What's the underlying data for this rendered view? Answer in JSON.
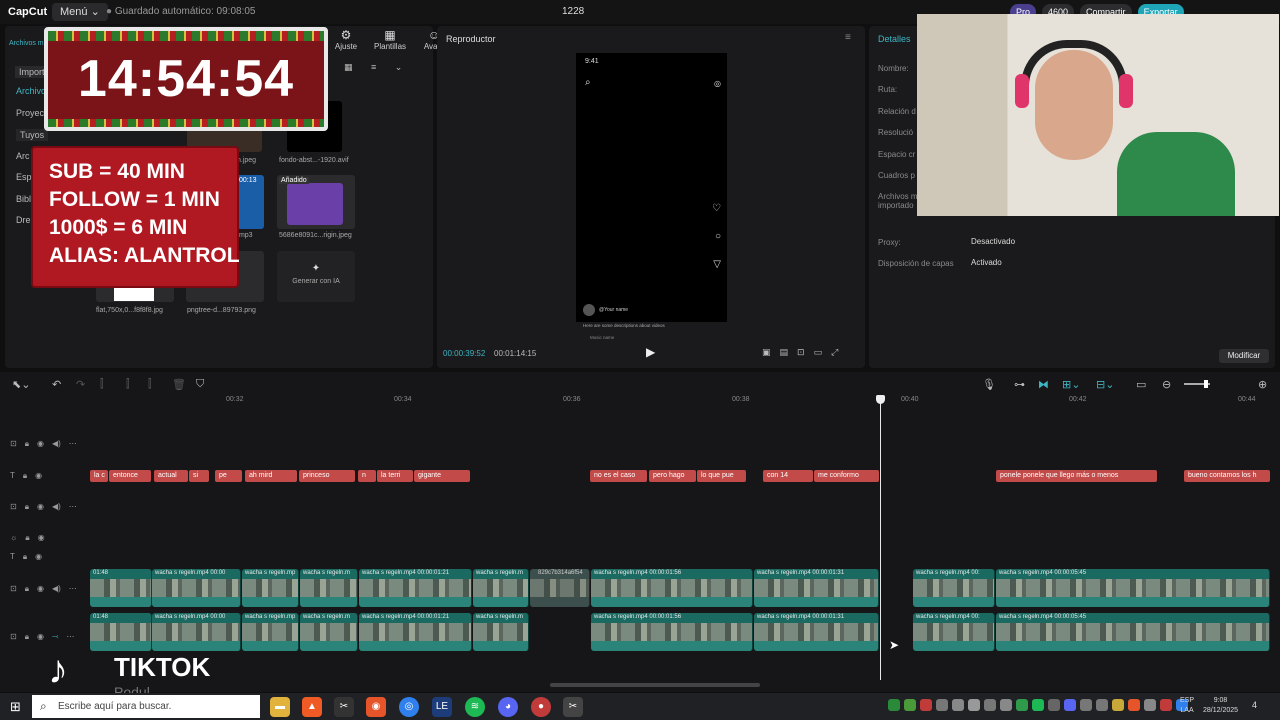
{
  "titlebar": {
    "app_name": "CapCut",
    "menu_label": "Menú ⌄",
    "autosave": "Guardado automático: 09:08:05",
    "project_name": "1228",
    "pro_label": "Pro",
    "coins": "4600",
    "share_label": "Compartir",
    "export_label": "Exportar"
  },
  "media_panel": {
    "nav": {
      "import": "Import",
      "archivos": "Archivo",
      "proyectos": "Proyect",
      "tuyos": "Tuyos",
      "arch2": "Arc",
      "esp": "Esp",
      "bibl": "Bibl",
      "dre": "Dre",
      "archivos_top": "Archivos m"
    },
    "tools": [
      {
        "icon": "⚙",
        "label": "Ajuste"
      },
      {
        "icon": "▦",
        "label": "Plantillas"
      },
      {
        "icon": "☺",
        "label": "Avata"
      }
    ],
    "thumbs": [
      {
        "caption": "n.jpeg"
      },
      {
        "caption": "fondo-abst...-1920.avif"
      },
      {
        "caption": ".mp3",
        "badge": "00:13"
      },
      {
        "caption": "5686e8091c...rigin.jpeg",
        "badge": "Añadido"
      },
      {
        "caption": "flat,750x,0...f8f8f8.jpg"
      },
      {
        "caption": "pngtree-d...89793.png"
      },
      {
        "caption": "Generar con IA"
      }
    ]
  },
  "overlays": {
    "clock": "14:54:54",
    "sub_lines": [
      "SUB = 40 MIN",
      "FOLLOW = 1 MIN",
      "1000$ = 6 MIN",
      "ALIAS: ALANTROL"
    ]
  },
  "player": {
    "title": "Reproductor",
    "phone_time": "9:41",
    "phone_user": "@Your name",
    "phone_desc": "Here are some descriptions about videos",
    "phone_music": "Music name",
    "current_time": "00:00:39:52",
    "total_time": "00:01:14:15"
  },
  "details": {
    "title": "Detalles",
    "labels": [
      "Nombre:",
      "Ruta:",
      "Relación d",
      "Resolució",
      "Espacio cr",
      "Cuadros p",
      "Archivos m importado"
    ],
    "proxy_label": "Proxy:",
    "proxy_value": "Desactivado",
    "layers_label": "Disposición de capas",
    "layers_value": "Activado",
    "modify_label": "Modificar"
  },
  "timeline": {
    "ruler": [
      "00:32",
      "00:34",
      "00:36",
      "00:38",
      "00:40",
      "00:42",
      "00:44"
    ],
    "text_clips": [
      "la c",
      "entonce",
      "actual",
      "si",
      "pe",
      "ah mird",
      "princeso",
      "n",
      "la terri",
      "gigante",
      "no es el caso",
      "pero hago",
      "lo que pue",
      "con 14",
      "me conformo",
      "ponele ponele que llego más o menos",
      "bueno contamos los h"
    ],
    "video_clips_top": [
      "01:48",
      "wacha s regeln.mp4  00:00",
      "wacha s regeln.mp",
      "wacha s regeln.m",
      "wacha s regeln.mp4  00:00:01:21",
      "wacha s regeln.m",
      "829c7b314a6f54",
      "wacha s regeln.mp4  00:00:01:56",
      "wacha s regeln.mp4  00:00:01:31",
      "wacha s regeln.mp4  00:",
      "wacha s regeln.mp4  00:00:05:45"
    ],
    "video_clips_bottom": [
      "01:48",
      "wacha s regeln.mp4  00:00",
      "wacha s regeln.mp",
      "wacha s regeln.m",
      "wacha s regeln.mp4  00:00:01:21",
      "wacha s regeln.m",
      "wacha s regeln.mp4  00:00:01:56",
      "wacha s regeln.mp4  00:00:01:31",
      "wacha s regeln.mp4  00:",
      "wacha s regeln.mp4  00:00:05:45"
    ]
  },
  "watermark": {
    "text": "TIKTOK",
    "sub": "Podul"
  },
  "taskbar": {
    "search_placeholder": "Escribe aquí para buscar.",
    "lang": "ESP\nLAA",
    "time": "9:08",
    "date": "28/12/2025",
    "notif": "4"
  },
  "colors": {
    "accent": "#3db6c4",
    "text_clip": "#c24a48",
    "video_clip": "#1b6a62",
    "clock_bg": "#7a1418",
    "sub_bg": "#b01822"
  }
}
